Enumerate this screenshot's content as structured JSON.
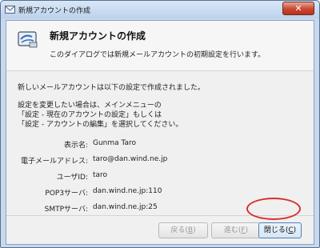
{
  "window": {
    "title": "新規アカウントの作成",
    "close_symbol": "✕"
  },
  "header": {
    "title": "新規アカウントの作成",
    "subtitle": "このダイアログでは新規メールアカウントの初期設定を行います。",
    "icon": "mail-account-icon"
  },
  "body": {
    "line1": "新しいメールアカウントは以下の設定で作成されました。",
    "line2": "設定を変更したい場合は、メインメニューの",
    "line3": "「設定 - 現在のアカウントの設定」もしくは",
    "line4": "「設定 - アカウントの編集」を選択してください。"
  },
  "fields": [
    {
      "label": "表示名:",
      "value": "Gunma Taro"
    },
    {
      "label": "電子メールアドレス:",
      "value": "taro@dan.wind.ne.jp"
    },
    {
      "label": "ユーザID:",
      "value": "taro"
    },
    {
      "label": "POP3サーバ:",
      "value": "dan.wind.ne.jp:110"
    },
    {
      "label": "SMTPサーバ:",
      "value": "dan.wind.ne.jp:25"
    }
  ],
  "buttons": {
    "back": {
      "label": "戻る(",
      "key": "B",
      "end": ")"
    },
    "next": {
      "label": "進む(",
      "key": "F",
      "end": ")"
    },
    "close": {
      "label": "閉じる(",
      "key": "C",
      "end": ")"
    }
  },
  "colors": {
    "highlight": "#d8302b",
    "close_button": "#c9462f"
  }
}
